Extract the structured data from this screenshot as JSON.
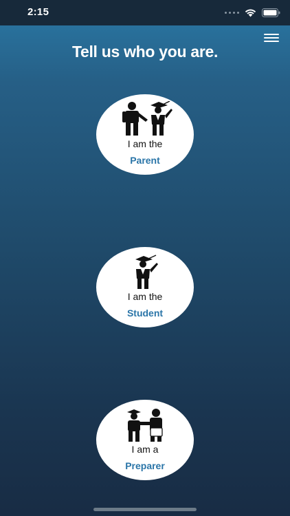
{
  "status_bar": {
    "time": "2:15"
  },
  "header": {
    "title": "Tell us who you are."
  },
  "roles": [
    {
      "prefix": "I am the",
      "name": "Parent",
      "icon": "parent-and-student-icon"
    },
    {
      "prefix": "I am the",
      "name": "Student",
      "icon": "graduate-student-icon"
    },
    {
      "prefix": "I am a",
      "name": "Preparer",
      "icon": "preparer-handshake-icon"
    }
  ],
  "colors": {
    "accent": "#2a75a8",
    "background_top": "#2a79a6",
    "background_bottom": "#182c44"
  }
}
